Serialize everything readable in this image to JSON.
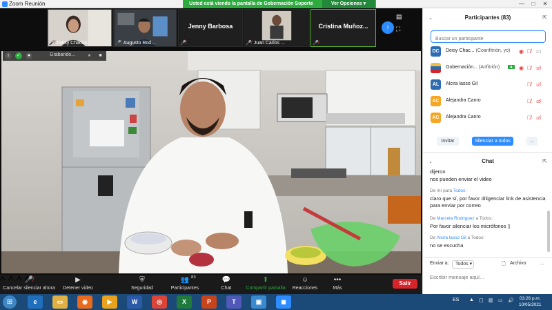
{
  "window": {
    "title": "Zoom Reunión",
    "minimize": "—",
    "maximize": "□",
    "close": "✕"
  },
  "share_banner": {
    "message": "Usted está viendo la pantalla de Gobernación Soporte",
    "options": "Ver Opciones ▾"
  },
  "thumbnails": [
    {
      "name": "Deisy Chacon",
      "muted": true
    },
    {
      "name": "Augusto Rod...",
      "muted": true
    },
    {
      "name": "Jenny Barbosa",
      "muted": true
    },
    {
      "name": "Juan Carlos ...",
      "muted": true
    },
    {
      "name": "Cristina  Muñoz...",
      "muted": true
    }
  ],
  "recording": {
    "label": "Grabando...",
    "pause_icon": "⏸",
    "stop_icon": "■"
  },
  "toolbar": {
    "mute": "Cancelar silenciar ahora",
    "video": "Detener video",
    "security": "Seguridad",
    "participants": "Participantes",
    "participants_count": "83",
    "chat": "Chat",
    "share": "Compartir pantalla",
    "reactions": "Reacciones",
    "more": "Más",
    "leave": "Salir"
  },
  "participants_panel": {
    "title": "Participantes (83)",
    "search_placeholder": "Buscar un participante",
    "list": [
      {
        "initials": "DC",
        "name": "Deisy Chac...",
        "role": "(Coanfitrión, yo)",
        "color": "#2d6cb0"
      },
      {
        "initials": "",
        "name": "Gobernación...",
        "role": "(Anfitrión)",
        "color": "#f0c040"
      },
      {
        "initials": "AL",
        "name": "Alcira lasso Gil",
        "role": "",
        "color": "#2d6cb0"
      },
      {
        "initials": "AC",
        "name": "Alejandra Canro",
        "role": "",
        "color": "#f5a623"
      },
      {
        "initials": "AC",
        "name": "Alejandra Canro",
        "role": "",
        "color": "#f5a623"
      }
    ],
    "invite": "Invitar",
    "mute_all": "Silenciar a todos",
    "more": "..."
  },
  "chat_panel": {
    "title": "Chat",
    "messages": [
      {
        "text": "dijeron"
      },
      {
        "text": "nos pueden enviar el video"
      },
      {
        "meta_from": "De mí para ",
        "meta_to": "Todos",
        "meta_after": ":"
      },
      {
        "text": "claro que sí, por favor diligenciar link de asistencia para enviar por correo"
      },
      {
        "meta_from": "De ",
        "meta_who": "Marcela Rodriguez",
        "meta_after": " a Todos:"
      },
      {
        "text": "Por favor silenciar los micrófonos ▯"
      },
      {
        "meta_from": "De ",
        "meta_who": "Alcira lasso Gil",
        "meta_after": " a Todos:"
      },
      {
        "text": "no se escucha"
      }
    ],
    "send_to_label": "Enviar a:",
    "send_to_value": "Todos ▾",
    "file_label": "Archivo",
    "more": "...",
    "input_placeholder": "Escribir mensaje aquí..."
  },
  "taskbar": {
    "language": "ES",
    "time": "03:26 p.m.",
    "date": "10/05/2021"
  },
  "colors": {
    "zoom_blue": "#2d8cff",
    "share_green": "#2dab3f",
    "leave_red": "#d7232a",
    "muted_red": "#e33333"
  }
}
